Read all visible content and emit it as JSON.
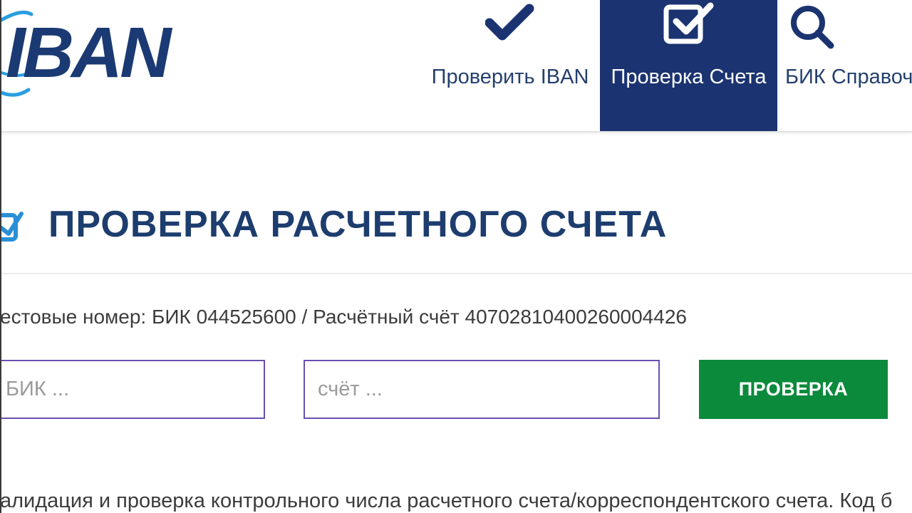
{
  "header": {
    "logo_text": "IBAN",
    "nav": [
      {
        "label": "Проверить IBAN",
        "icon": "checkmark-icon",
        "active": false
      },
      {
        "label": "Проверка Счета",
        "icon": "checkbox-checked-icon",
        "active": true
      },
      {
        "label": "БИК Справоч",
        "icon": "search-icon",
        "active": false
      }
    ]
  },
  "main": {
    "title": "ПРОВЕРКА РАСЧЕТНОГО СЧЕТА",
    "title_icon": "checkbox-edit-icon",
    "test_numbers": "естовые номер: БИК 044525600 / Расчётный счёт 40702810400260004426",
    "form": {
      "bik_placeholder": "БИК ...",
      "account_placeholder": "счёт ...",
      "submit_label": "ПРОВЕРКА"
    },
    "description": "алидация и проверка контрольного числа расчетного счета/корреспондентского счета. Код б"
  },
  "colors": {
    "brand_navy": "#1b3370",
    "title_text": "#1d3d6e",
    "submit_green": "#0b8a3b",
    "input_border": "#6a4fb0",
    "logo_swoosh": "#2a9ee0"
  }
}
